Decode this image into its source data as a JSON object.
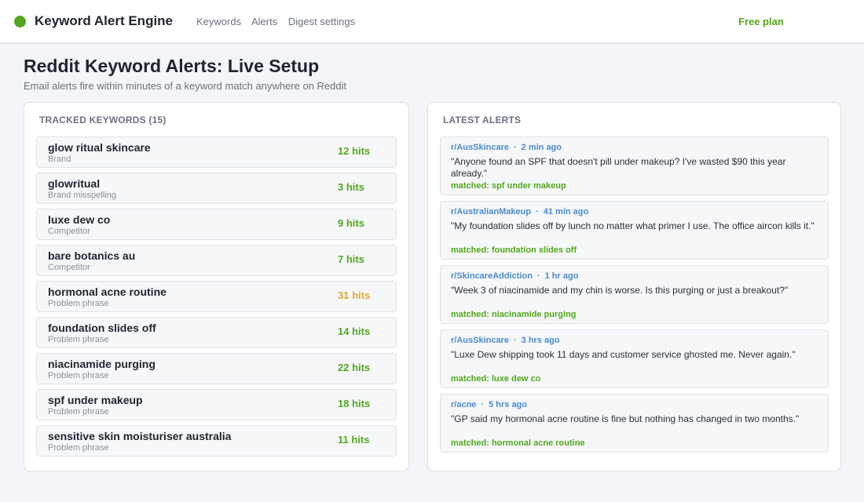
{
  "app": {
    "name": "Keyword Alert Engine",
    "nav": [
      "Keywords",
      "Alerts",
      "Digest settings"
    ],
    "plan": "Free plan"
  },
  "page": {
    "title": "Reddit Keyword Alerts: Live Setup",
    "subtitle": "Email alerts fire within minutes of a keyword match anywhere on Reddit"
  },
  "keywords_panel": {
    "heading": "TRACKED KEYWORDS (15)",
    "items": [
      {
        "term": "glow ritual skincare",
        "type": "Brand",
        "hits": "12 hits"
      },
      {
        "term": "glowritual",
        "type": "Brand misspelling",
        "hits": "3 hits"
      },
      {
        "term": "luxe dew co",
        "type": "Competitor",
        "hits": "9 hits"
      },
      {
        "term": "bare botanics au",
        "type": "Competitor",
        "hits": "7 hits"
      },
      {
        "term": "hormonal acne routine",
        "type": "Problem phrase",
        "hits": "31 hits",
        "hot": true
      },
      {
        "term": "foundation slides off",
        "type": "Problem phrase",
        "hits": "14 hits"
      },
      {
        "term": "niacinamide purging",
        "type": "Problem phrase",
        "hits": "22 hits"
      },
      {
        "term": "spf under makeup",
        "type": "Problem phrase",
        "hits": "18 hits"
      },
      {
        "term": "sensitive skin moisturiser australia",
        "type": "Problem phrase",
        "hits": "11 hits"
      }
    ]
  },
  "alerts_panel": {
    "heading": "LATEST ALERTS",
    "separator": "·",
    "items": [
      {
        "subreddit": "r/AusSkincare",
        "time": "2 min ago",
        "quote": "\"Anyone found an SPF that doesn't pill under makeup? I've wasted $90 this year already.\"",
        "match": "matched: spf under makeup"
      },
      {
        "subreddit": "r/AustralianMakeup",
        "time": "41 min ago",
        "quote": "\"My foundation slides off by lunch no matter what primer I use. The office aircon kills it.\"",
        "match": "matched: foundation slides off"
      },
      {
        "subreddit": "r/SkincareAddiction",
        "time": "1 hr ago",
        "quote": "\"Week 3 of niacinamide and my chin is worse. Is this purging or just a breakout?\"",
        "match": "matched: niacinamide purging"
      },
      {
        "subreddit": "r/AusSkincare",
        "time": "3 hrs ago",
        "quote": "\"Luxe Dew shipping took 11 days and customer service ghosted me. Never again.\"",
        "match": "matched: luxe dew co"
      },
      {
        "subreddit": "r/acne",
        "time": "5 hrs ago",
        "quote": "\"GP said my hormonal acne routine is fine but nothing has changed in two months.\"",
        "match": "matched: hormonal acne routine"
      }
    ]
  },
  "colors": {
    "accent_green": "#52a81c",
    "hot_amber": "#e4a73a",
    "link_blue": "#4a8bd0"
  }
}
